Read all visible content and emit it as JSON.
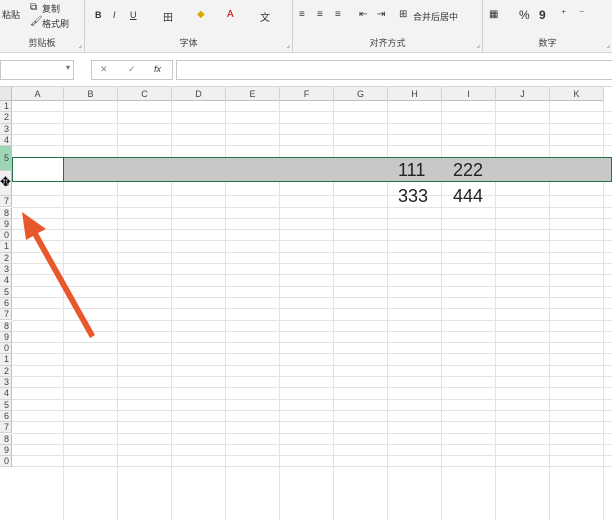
{
  "ribbon": {
    "paste_label": "粘贴",
    "copy_label": "复制",
    "format_painter_label": "格式刷",
    "clipboard_label": "剪贴板",
    "font_label": "字体",
    "bold": "B",
    "italic": "I",
    "underline": "U",
    "align_label": "对齐方式",
    "merge_label": "合并后居中",
    "number_label": "数字",
    "percent": "%",
    "comma": "9"
  },
  "formula_bar": {
    "fx": "fx",
    "cancel": "✕",
    "confirm": "✓"
  },
  "columns": [
    "A",
    "B",
    "C",
    "D",
    "E",
    "F",
    "G",
    "H",
    "I",
    "J",
    "K"
  ],
  "rows": [
    "1",
    "2",
    "3",
    "4",
    "5",
    "6",
    "7",
    "8",
    "9",
    "0",
    "1",
    "2",
    "3",
    "4",
    "5",
    "6",
    "7",
    "8",
    "9",
    "0",
    "1",
    "2",
    "3",
    "4",
    "5",
    "6",
    "7",
    "8",
    "9",
    "0"
  ],
  "cells": {
    "h_row1": "111",
    "i_row1": "222",
    "h_row2": "333",
    "i_row2": "444"
  },
  "colors": {
    "selection": "#c8c8c8",
    "accent_green": "#217346",
    "arrow": "#e8582b"
  }
}
